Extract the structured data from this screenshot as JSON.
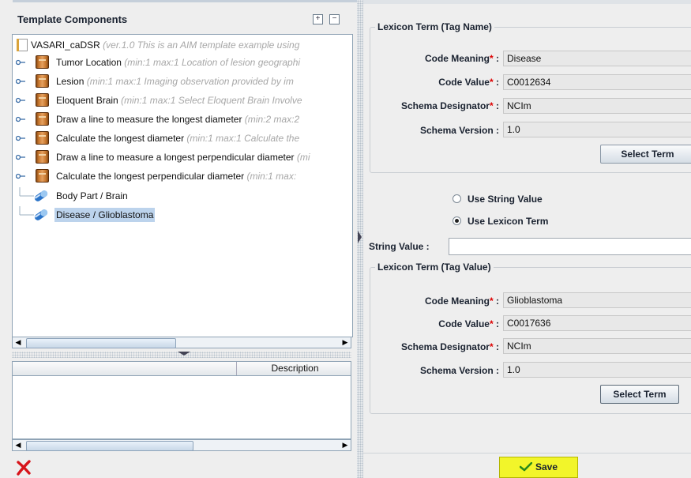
{
  "template_panel": {
    "title": "Template Components",
    "expand_icon": "plus-box-icon",
    "collapse_icon": "minus-box-icon",
    "tree": {
      "root": {
        "name": "VASARI_caDSR",
        "hint": " (ver.1.0 This is an AIM template example using"
      },
      "items": [
        {
          "name": "Tumor Location",
          "hint": " (min:1 max:1 Location of lesion geographi",
          "icon": "component-book-icon"
        },
        {
          "name": "Lesion",
          "hint": " (min:1 max:1 Imaging observation provided by im",
          "icon": "component-book-icon"
        },
        {
          "name": "Eloquent Brain",
          "hint": " (min:1 max:1 Select Eloquent Brain Involve",
          "icon": "component-book-icon"
        },
        {
          "name": "Draw a line to measure the longest diameter",
          "hint": " (min:2 max:2",
          "icon": "component-book-icon"
        },
        {
          "name": "Calculate the longest diameter",
          "hint": " (min:1 max:1 Calculate the",
          "icon": "component-book-icon"
        },
        {
          "name": "Draw a line to measure a longest perpendicular diameter",
          "hint": " (mi",
          "icon": "component-book-icon"
        },
        {
          "name": "Calculate the longest perpendicular diameter",
          "hint": " (min:1 max:",
          "icon": "component-book-icon"
        }
      ],
      "tags": [
        {
          "name": "Body Part / Brain",
          "icon": "tag-pill-icon",
          "selected": false
        },
        {
          "name": "Disease  / Glioblastoma",
          "icon": "tag-pill-icon",
          "selected": true
        }
      ]
    },
    "description_header": "Description",
    "delete_icon": "red-x-delete-icon"
  },
  "tag_name": {
    "legend": "Lexicon Term (Tag Name)",
    "code_meaning_label": "Code Meaning",
    "code_meaning": "Disease",
    "code_value_label": "Code Value",
    "code_value": "C0012634",
    "schema_designator_label": "Schema Designator",
    "schema_designator": "NCIm",
    "schema_version_label": "Schema Version",
    "schema_version": "1.0",
    "select_term": "Select Term"
  },
  "value_mode": {
    "use_string_value": "Use String Value",
    "use_lexicon_term": "Use Lexicon Term",
    "selected": "lexicon"
  },
  "string_value": {
    "label": "String Value :",
    "value": ""
  },
  "tag_value": {
    "legend": "Lexicon Term (Tag Value)",
    "code_meaning_label": "Code Meaning",
    "code_meaning": "Glioblastoma",
    "code_value_label": "Code Value",
    "code_value": "C0017636",
    "schema_designator_label": "Schema Designator",
    "schema_designator": "NCIm",
    "schema_version_label": "Schema Version",
    "schema_version": "1.0",
    "select_term": "Select Term"
  },
  "required_marker": "*",
  "colon": ":",
  "save_label": "Save",
  "colors": {
    "save_bg": "#f2f52a",
    "selection": "#bcd3ec",
    "required": "#dd0000"
  }
}
